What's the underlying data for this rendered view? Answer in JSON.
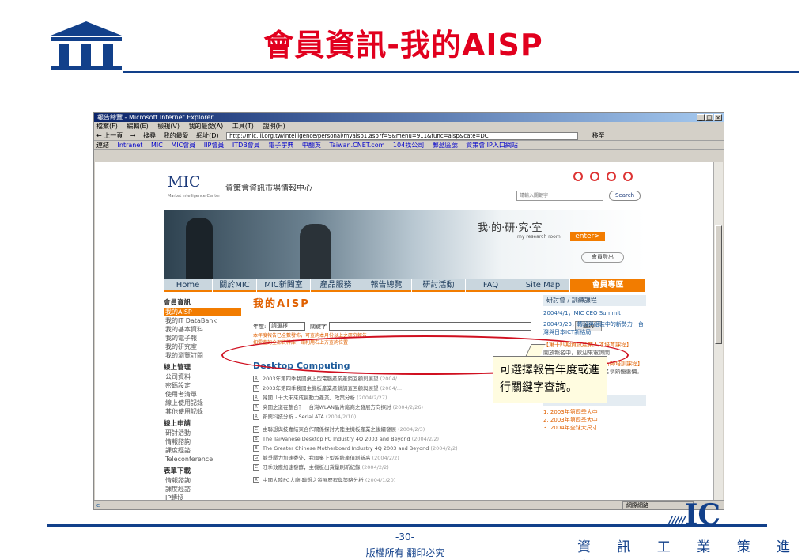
{
  "slide": {
    "title": "會員資訊-我的AISP",
    "footer_mic": "IC",
    "page_number": "-30-",
    "copyright": "版權所有 翻印必究",
    "org": "資 訊 工 業 策 進 會",
    "callout": "可選擇報告年度或進行關鍵字查詢。"
  },
  "browser": {
    "title": "報告總覽 - Microsoft Internet Explorer",
    "menu": [
      "檔案(F)",
      "編輯(E)",
      "檢視(V)",
      "我的最愛(A)",
      "工具(T)",
      "說明(H)"
    ],
    "toolbar": [
      "← 上一頁",
      "→",
      "搜尋",
      "我的最愛",
      "網址(D)"
    ],
    "address": "http://mic.iii.org.tw/intelligence/personal/myaisp1.asp?f=9&menu=911&func=aisp&cate=DC",
    "go_label": "移至",
    "links_label": "連結",
    "links": [
      "Intranet",
      "MIC",
      "MIC會員",
      "IIP會員",
      "ITDB會員",
      "電子字典",
      "中翻英",
      "Taiwan.CNET.com",
      "104找公司",
      "郵遞區號",
      "資策會IIP入口網站"
    ],
    "status_zone": "網際網路"
  },
  "site": {
    "logo": "MIC",
    "center_name": "資策會資訊市場情報中心",
    "subtitle": "Market Intelligence Center",
    "search_placeholder": "請輸入關鍵字",
    "search_button": "Search",
    "banner_text": "我·的·研·究·室",
    "banner_sub": "my research room",
    "enter": "enter>",
    "logout": "會員登出",
    "nav": [
      "Home",
      "關於MIC",
      "MIC新聞室",
      "產品服務",
      "報告總覽",
      "研討活動",
      "FAQ",
      "Site Map",
      "會員專區"
    ]
  },
  "sidebar": [
    {
      "head": "會員資訊",
      "items": [
        "我的AISP",
        "我的IT DataBank",
        "我的基本資料",
        "我的電子報",
        "我的研究室",
        "我的瀏覽訂閱"
      ]
    },
    {
      "head": "線上管理",
      "items": [
        "公司資料",
        "密碼設定",
        "使用者清單",
        "線上使用記錄",
        "其他使用記錄"
      ]
    },
    {
      "head": "線上申請",
      "items": [
        "研討活動",
        "情報諮詢",
        "課度經諮",
        "Teleconference"
      ]
    },
    {
      "head": "表單下載",
      "items": [
        "情報諮詢",
        "課度經諮",
        "IP轉授"
      ]
    }
  ],
  "main": {
    "heading": "我的AISP",
    "year_label": "年度:",
    "year_select": "請選擇",
    "keyword_label": "關鍵字",
    "query_button": "查詢",
    "note1": "本年度報告已全數發佈，可查詢本月份以上之研究報告",
    "note2": "如需查詢全部資料庫，請利用右上方查詢位置",
    "section": "Desktop Computing",
    "reports": [
      {
        "tag": "R",
        "title": "2003年第四季我國桌上型電腦產業產銷回顧與展望",
        "date": "(2004/..."
      },
      {
        "tag": "R",
        "title": "2003年第四季我國主機板產業產銷調查回顧與展望",
        "date": "(2004/..."
      },
      {
        "tag": "R",
        "title": "韓國「十大未來成長動力產業」政策分析",
        "date": "(2004/2/27)"
      },
      {
        "tag": "R",
        "title": "突圍之道在整合？－台灣WLAN晶片廠商之發展方向探討",
        "date": "(2004/2/26)"
      },
      {
        "tag": "R",
        "title": "新興科技分析 - Serial ATA",
        "date": "(2004/2/10)"
      },
      {
        "tag": "G",
        "title": "由聯想與技嘉結束合作關係探討大陸主機板產業之後續發展",
        "date": "(2004/2/3)"
      },
      {
        "tag": "B",
        "title": "The Taiwanese Desktop PC Industry 4Q 2003 and Beyond",
        "date": "(2004/2/2)"
      },
      {
        "tag": "B",
        "title": "The Greater Chinese Motherboard Industry 4Q 2003 and Beyond",
        "date": "(2004/2/2)"
      },
      {
        "tag": "G",
        "title": "競爭壓力加速委外，我國桌上型系統產值創新高",
        "date": "(2004/2/2)"
      },
      {
        "tag": "G",
        "title": "旺季效應加速發酵，主機板出貨量刷新紀錄",
        "date": "(2004/2/2)"
      },
      {
        "tag": "R",
        "title": "中國大陸PC大廠-聯想之發展歷程與策略分析",
        "date": "(2004/1/20)"
      }
    ]
  },
  "right": {
    "head1": "研討會 / 訓練課程",
    "items": [
      "2004/4/1，MIC CEO Summit",
      "2004/3/23，轉殼與組裝中的新勢力－台灣與日本ICT新格局",
      "【第十四期資訊產業人才培育課程】",
      "開放報名中，歡迎來電詢問",
      "【第十四期高科技產業分析師培訓課程】",
      "鄭重推薦，3月15日前報名享熱優惠價，額滿即止。"
    ],
    "head2": "近期點閱記錄",
    "recent": [
      "1. 2003年第四季大中",
      "2. 2003年第四季大中",
      "3. 2004年全球大尺寸"
    ]
  }
}
